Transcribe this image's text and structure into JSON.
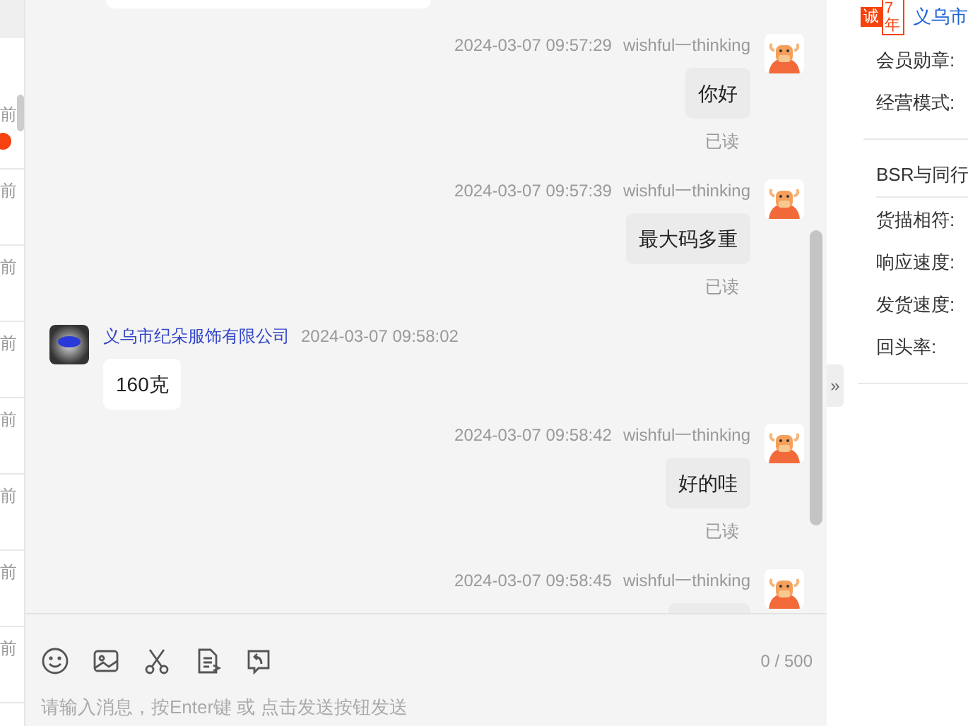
{
  "conversation_list": [
    {
      "time": "前",
      "unread": true
    },
    {
      "time": "前",
      "unread": false
    },
    {
      "time": "前",
      "unread": false
    },
    {
      "time": "前",
      "unread": false
    },
    {
      "time": "前",
      "unread": false
    },
    {
      "time": "前",
      "unread": false
    },
    {
      "time": "前",
      "unread": false
    },
    {
      "time": "前",
      "unread": false
    }
  ],
  "messages": [
    {
      "kind": "self",
      "time": "2024-03-07 09:57:29",
      "sender": "wishful一thinking",
      "text": "你好",
      "read_status": "已读"
    },
    {
      "kind": "self",
      "time": "2024-03-07 09:57:39",
      "sender": "wishful一thinking",
      "text": "最大码多重",
      "read_status": "已读"
    },
    {
      "kind": "other",
      "time": "2024-03-07 09:58:02",
      "sender": "义乌市纪朵服饰有限公司",
      "text": "160克"
    },
    {
      "kind": "self",
      "time": "2024-03-07 09:58:42",
      "sender": "wishful一thinking",
      "text": "好的哇",
      "read_status": "已读"
    },
    {
      "kind": "self",
      "time": "2024-03-07 09:58:45",
      "sender": "wishful一thinking"
    }
  ],
  "panel_toggle": "»",
  "composer": {
    "counter": "0 / 500",
    "placeholder": "请输入消息，按Enter键 或 点击发送按钮发送"
  },
  "shop_panel": {
    "badge": "诚",
    "years": "7年",
    "shop_name": "义乌市",
    "fields": [
      "会员勋章:",
      "经营模式:"
    ],
    "bsr_label": "BSR与同行",
    "ratings": [
      "货描相符:",
      "响应速度:",
      "发货速度:",
      "回头率:"
    ]
  }
}
